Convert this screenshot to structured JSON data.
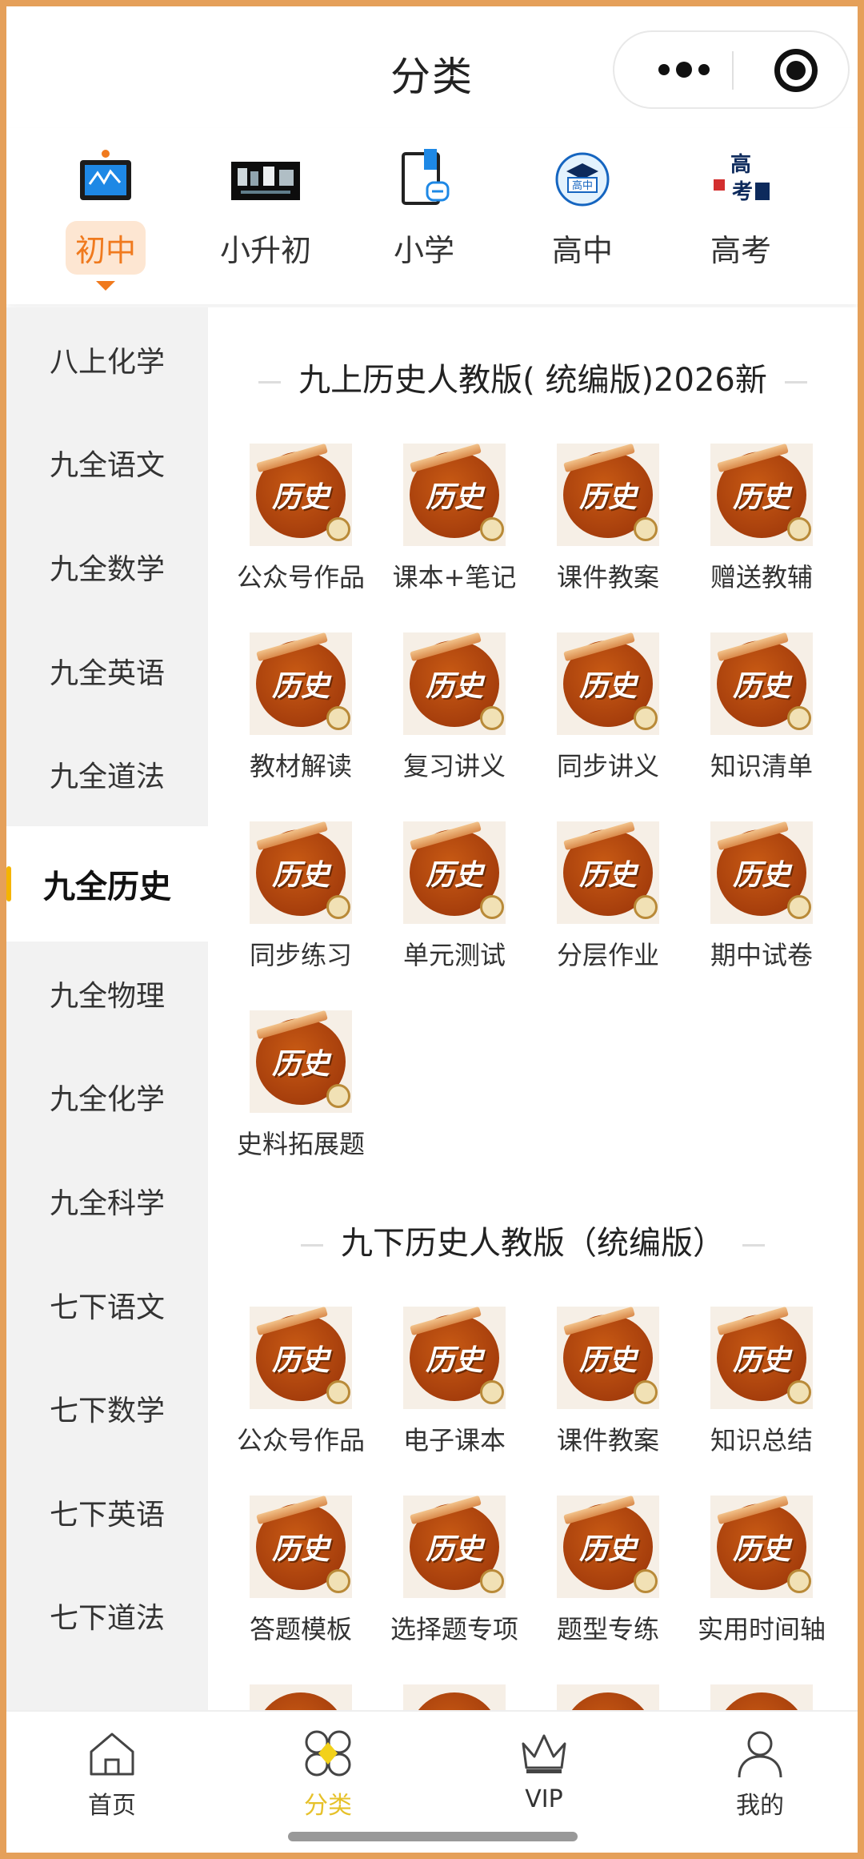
{
  "title_bar": {
    "title": "分类"
  },
  "grade_tabs": [
    {
      "label": "初中",
      "icon": "monitor-icon",
      "active": true
    },
    {
      "label": "小升初",
      "icon": "promo-image-icon",
      "active": false
    },
    {
      "label": "小学",
      "icon": "book-link-icon",
      "active": false
    },
    {
      "label": "高中",
      "icon": "graduation-cap-icon",
      "active": false
    },
    {
      "label": "高考",
      "icon": "exam-building-icon",
      "active": false
    }
  ],
  "sidebar": {
    "items": [
      {
        "label": "八上化学"
      },
      {
        "label": "九全语文"
      },
      {
        "label": "九全数学"
      },
      {
        "label": "九全英语"
      },
      {
        "label": "九全道法"
      },
      {
        "label": "九全历史",
        "active": true
      },
      {
        "label": "九全物理"
      },
      {
        "label": "九全化学"
      },
      {
        "label": "九全科学"
      },
      {
        "label": "七下语文"
      },
      {
        "label": "七下数学"
      },
      {
        "label": "七下英语"
      },
      {
        "label": "七下道法"
      }
    ]
  },
  "sections": [
    {
      "title": "九上历史人教版( 统编版)2026新",
      "icon_text": "历史",
      "items": [
        "公众号作品",
        "课本+笔记",
        "课件教案",
        "赠送教辅",
        "教材解读",
        "复习讲义",
        "同步讲义",
        "知识清单",
        "同步练习",
        "单元测试",
        "分层作业",
        "期中试卷",
        "史料拓展题"
      ]
    },
    {
      "title": "九下历史人教版（统编版）",
      "icon_text": "历史",
      "items": [
        "公众号作品",
        "电子课本",
        "课件教案",
        "知识总结",
        "答题模板",
        "选择题专项",
        "题型专练",
        "实用时间轴"
      ]
    }
  ],
  "bottom_nav": [
    {
      "label": "首页",
      "icon": "home-icon",
      "active": false
    },
    {
      "label": "分类",
      "icon": "category-icon",
      "active": true
    },
    {
      "label": "VIP",
      "icon": "crown-icon",
      "active": false
    },
    {
      "label": "我的",
      "icon": "user-icon",
      "active": false
    }
  ],
  "colors": {
    "accent_orange": "#f07a1e",
    "accent_yellow": "#e6c12a",
    "history_icon_brown": "#a63e0c",
    "frame": "#e5a05a"
  }
}
